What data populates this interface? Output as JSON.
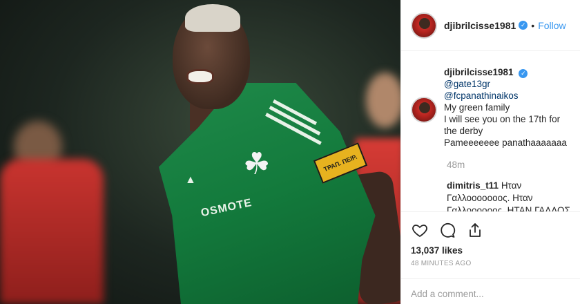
{
  "post": {
    "username": "djibrilcisse1981",
    "follow_label": "Follow",
    "separator": "•",
    "verified_mark": "✓",
    "image": {
      "sponsor_text": "OSMOTE",
      "armband_text": "ΤΡΑΠ. ΠΕΙΡ.",
      "brand_mark": "adidas"
    }
  },
  "caption": {
    "username": "djibrilcisse1981",
    "mention_1": "@gate13gr",
    "mention_2": "@fcpanathinaikos",
    "line_1": "My green family",
    "line_2": "I will see you on the 17th for the derby",
    "line_3": "Pameeeeeee panathaaaaaaa",
    "time": "48m"
  },
  "comments": [
    {
      "username": "dimitris_t11",
      "text": "Ηταν Γαλλοοοοοοος. Ηταν Γαλλοοοοοος. ΗΤΑΝ ΓΑΛΛΟΣ Ο"
    }
  ],
  "actions": {
    "icons": [
      "heart-icon",
      "comment-icon",
      "share-icon"
    ],
    "likes": "13,037 likes",
    "time_ago": "48 MINUTES AGO",
    "add_comment_placeholder": "Add a comment..."
  },
  "colors": {
    "accent": "#3897f0",
    "jersey_green": "#137a3c",
    "muted": "#999999"
  }
}
